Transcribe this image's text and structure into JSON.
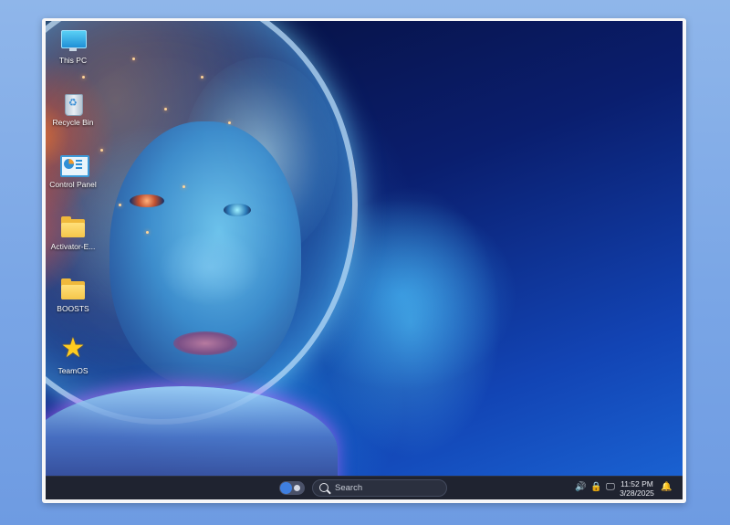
{
  "desktop": {
    "icons": [
      {
        "label": "This PC",
        "icon": "this-pc-icon"
      },
      {
        "label": "Recycle Bin",
        "icon": "recycle-bin-icon"
      },
      {
        "label": "Control Panel",
        "icon": "control-panel-icon"
      },
      {
        "label": "Activator-E...",
        "icon": "folder-icon"
      },
      {
        "label": "BOOSTS",
        "icon": "folder-icon"
      },
      {
        "label": "TeamOS",
        "icon": "star-icon"
      }
    ]
  },
  "taskbar": {
    "search_placeholder": "Search",
    "tray": {
      "volume_icon": "speaker-icon",
      "security_icon": "lock-icon",
      "display_icon": "monitor-icon",
      "notification_icon": "bell-icon",
      "volume_glyph": "🔊",
      "security_glyph": "🔒",
      "display_glyph": "🖵",
      "bell_glyph": "🔔"
    },
    "clock": {
      "time": "11:52 PM",
      "date": "3/28/2025"
    }
  },
  "colors": {
    "taskbar_bg": "#1f2330",
    "accent": "#3f7fe0",
    "page_bg": "#7aa6e6"
  }
}
